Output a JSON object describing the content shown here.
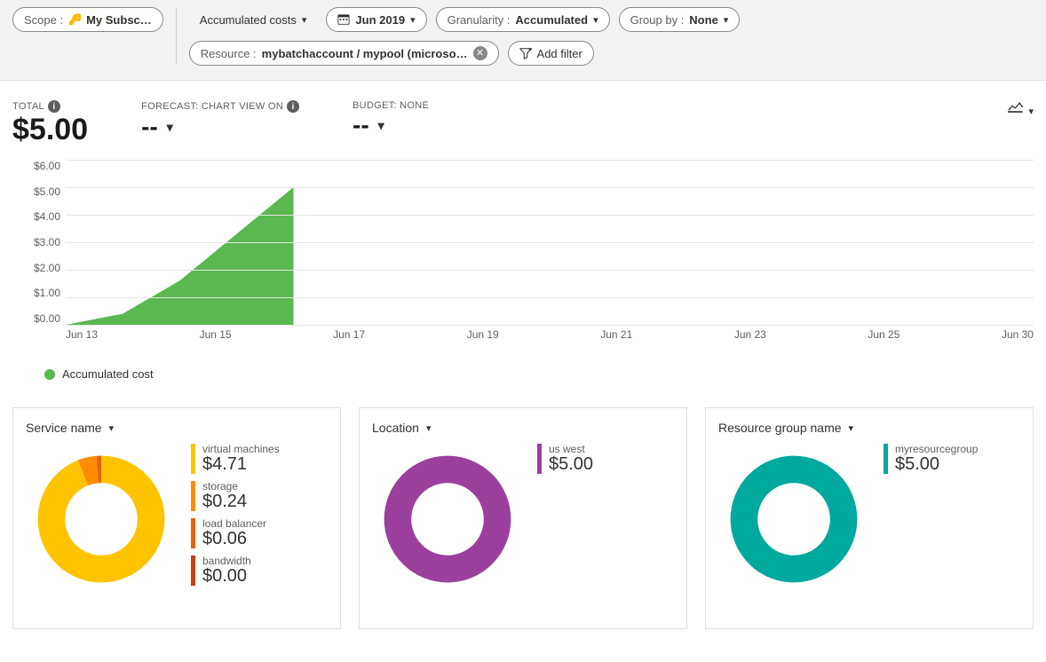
{
  "filters": {
    "scope_label": "Scope :",
    "scope_value": "My Subsc…",
    "view": "Accumulated costs",
    "date": "Jun 2019",
    "granularity_label": "Granularity :",
    "granularity_value": "Accumulated",
    "groupby_label": "Group by :",
    "groupby_value": "None",
    "resource_label": "Resource :",
    "resource_value": "mybatchaccount / mypool (microso…",
    "add_filter": "Add filter"
  },
  "summary": {
    "total_label": "TOTAL",
    "total_value": "$5.00",
    "forecast_label": "FORECAST: CHART VIEW ON",
    "forecast_value": "--",
    "budget_label": "BUDGET: NONE",
    "budget_value": "--"
  },
  "legend": {
    "series_name": "Accumulated cost",
    "series_color": "#5bb750"
  },
  "chart_data": {
    "type": "area",
    "title": "",
    "xlabel": "",
    "ylabel": "",
    "ylim": [
      0,
      6
    ],
    "y_ticks": [
      "$6.00",
      "$5.00",
      "$4.00",
      "$3.00",
      "$2.00",
      "$1.00",
      "$0.00"
    ],
    "x_ticks": [
      "Jun 13",
      "Jun 15",
      "Jun 17",
      "Jun 19",
      "Jun 21",
      "Jun 23",
      "Jun 25",
      "Jun 30"
    ],
    "series": [
      {
        "name": "Accumulated cost",
        "color": "#5bb750",
        "points": [
          {
            "x": "Jun 13",
            "y": 0.0
          },
          {
            "x": "Jun 14",
            "y": 0.4
          },
          {
            "x": "Jun 15",
            "y": 1.6
          },
          {
            "x": "Jun 16",
            "y": 3.3
          },
          {
            "x": "Jun 17",
            "y": 5.0
          }
        ]
      }
    ]
  },
  "cards": {
    "service": {
      "title": "Service name",
      "items": [
        {
          "name": "virtual machines",
          "value": "$4.71",
          "num": 4.71,
          "color": "#ffc300"
        },
        {
          "name": "storage",
          "value": "$0.24",
          "num": 0.24,
          "color": "#ff8c00"
        },
        {
          "name": "load balancer",
          "value": "$0.06",
          "num": 0.06,
          "color": "#e8600f"
        },
        {
          "name": "bandwidth",
          "value": "$0.00",
          "num": 0.0,
          "color": "#c93f14"
        }
      ]
    },
    "location": {
      "title": "Location",
      "items": [
        {
          "name": "us west",
          "value": "$5.00",
          "num": 5.0,
          "color": "#9b3f9c"
        }
      ]
    },
    "resourcegroup": {
      "title": "Resource group name",
      "items": [
        {
          "name": "myresourcegroup",
          "value": "$5.00",
          "num": 5.0,
          "color": "#00a99d"
        }
      ]
    }
  }
}
